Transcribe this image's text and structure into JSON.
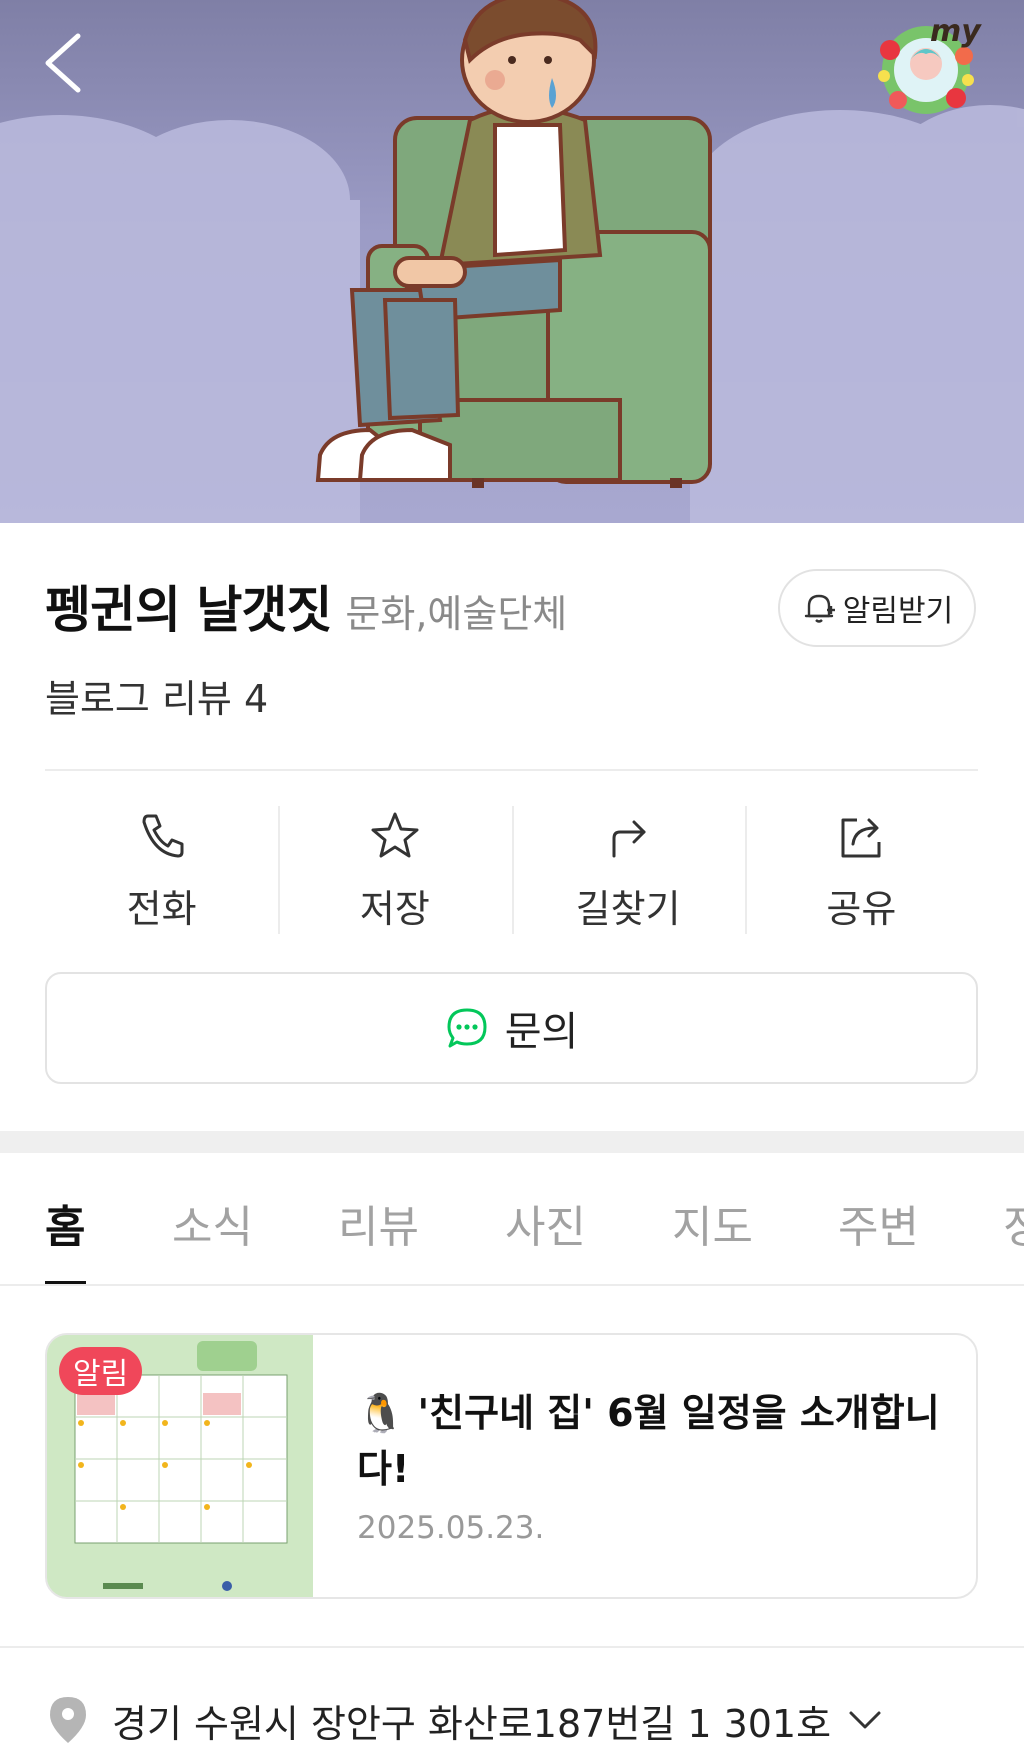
{
  "header": {
    "back_icon": "chevron-left-icon",
    "badge_text": "my",
    "badge_icon": "my-profile-wreath-icon"
  },
  "place": {
    "name": "펭귄의 날갯짓",
    "category": "문화,예술단체",
    "review_label": "블로그 리뷰 4",
    "notify_label": "알림받기"
  },
  "actions": [
    {
      "label": "전화",
      "icon": "phone-icon"
    },
    {
      "label": "저장",
      "icon": "star-icon"
    },
    {
      "label": "길찾기",
      "icon": "directions-icon"
    },
    {
      "label": "공유",
      "icon": "share-icon"
    }
  ],
  "inquiry": {
    "label": "문의",
    "icon": "chat-bubble-icon"
  },
  "tabs": [
    "홈",
    "소식",
    "리뷰",
    "사진",
    "지도",
    "주변",
    "정"
  ],
  "news": {
    "badge": "알림",
    "title": "🐧 '친구네 집' 6월 일정을 소개합니다!",
    "date": "2025.05.23."
  },
  "address": {
    "text": "경기 수원시 장안구 화산로187번길 1 301호",
    "icon": "location-pin-icon"
  },
  "colors": {
    "accent_green": "#03c75a",
    "badge_red": "#f0475a",
    "hero_bg": "#9c9cc6"
  }
}
